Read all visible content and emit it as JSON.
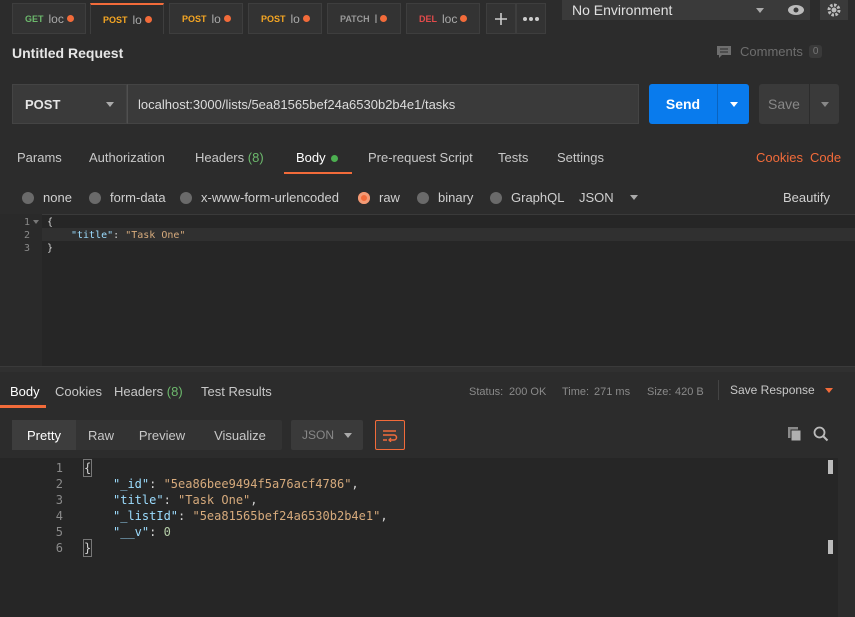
{
  "tabs": [
    {
      "method": "GET",
      "url": "loc",
      "color": "#6cb86c"
    },
    {
      "method": "POST",
      "url": "lo",
      "color": "#f5a623"
    },
    {
      "method": "POST",
      "url": "lo",
      "color": "#f5a623"
    },
    {
      "method": "POST",
      "url": "lo",
      "color": "#f5a623"
    },
    {
      "method": "PATCH",
      "url": "l",
      "color": "#999999"
    },
    {
      "method": "DEL",
      "url": "loc",
      "color": "#e34b4b"
    }
  ],
  "tabbar": {
    "add_icon": "plus-icon",
    "more_icon": "more-icon"
  },
  "environment": {
    "selected": "No Environment"
  },
  "request": {
    "title": "Untitled Request",
    "comments_label": "Comments",
    "comments_count": "0",
    "method": "POST",
    "url": "localhost:3000/lists/5ea81565bef24a6530b2b4e1/tasks",
    "send_label": "Send",
    "save_label": "Save"
  },
  "req_tabs": {
    "params": "Params",
    "authorization": "Authorization",
    "headers": "Headers",
    "headers_count": "(8)",
    "body": "Body",
    "prerequest": "Pre-request Script",
    "tests": "Tests",
    "settings": "Settings",
    "cookies": "Cookies",
    "code": "Code"
  },
  "body_types": {
    "none": "none",
    "form_data": "form-data",
    "urlencoded": "x-www-form-urlencoded",
    "raw": "raw",
    "binary": "binary",
    "graphql": "GraphQL",
    "format": "JSON",
    "beautify": "Beautify"
  },
  "editor": {
    "ln1": "1",
    "ln2": "2",
    "ln3": "3",
    "open": "{",
    "key": "\"title\"",
    "colon": ":",
    "value": "\"Task One\"",
    "close": "}"
  },
  "resp_tabs": {
    "body": "Body",
    "cookies": "Cookies",
    "headers": "Headers",
    "headers_count": "(8)",
    "test_results": "Test Results",
    "status_label": "Status:",
    "status_value": "200 OK",
    "time_label": "Time:",
    "time_value": "271 ms",
    "size_label": "Size:",
    "size_value": "420 B",
    "save_response": "Save Response"
  },
  "view": {
    "pretty": "Pretty",
    "raw": "Raw",
    "preview": "Preview",
    "visualize": "Visualize",
    "format": "JSON"
  },
  "response": {
    "lines": [
      "1",
      "2",
      "3",
      "4",
      "5",
      "6"
    ],
    "open": "{",
    "k1": "\"_id\"",
    "v1": "\"5ea86bee9494f5a76acf4786\"",
    "k2": "\"title\"",
    "v2": "\"Task One\"",
    "k3": "\"_listId\"",
    "v3": "\"5ea81565bef24a6530b2b4e1\"",
    "k4": "\"__v\"",
    "v4": "0",
    "close": "}"
  }
}
